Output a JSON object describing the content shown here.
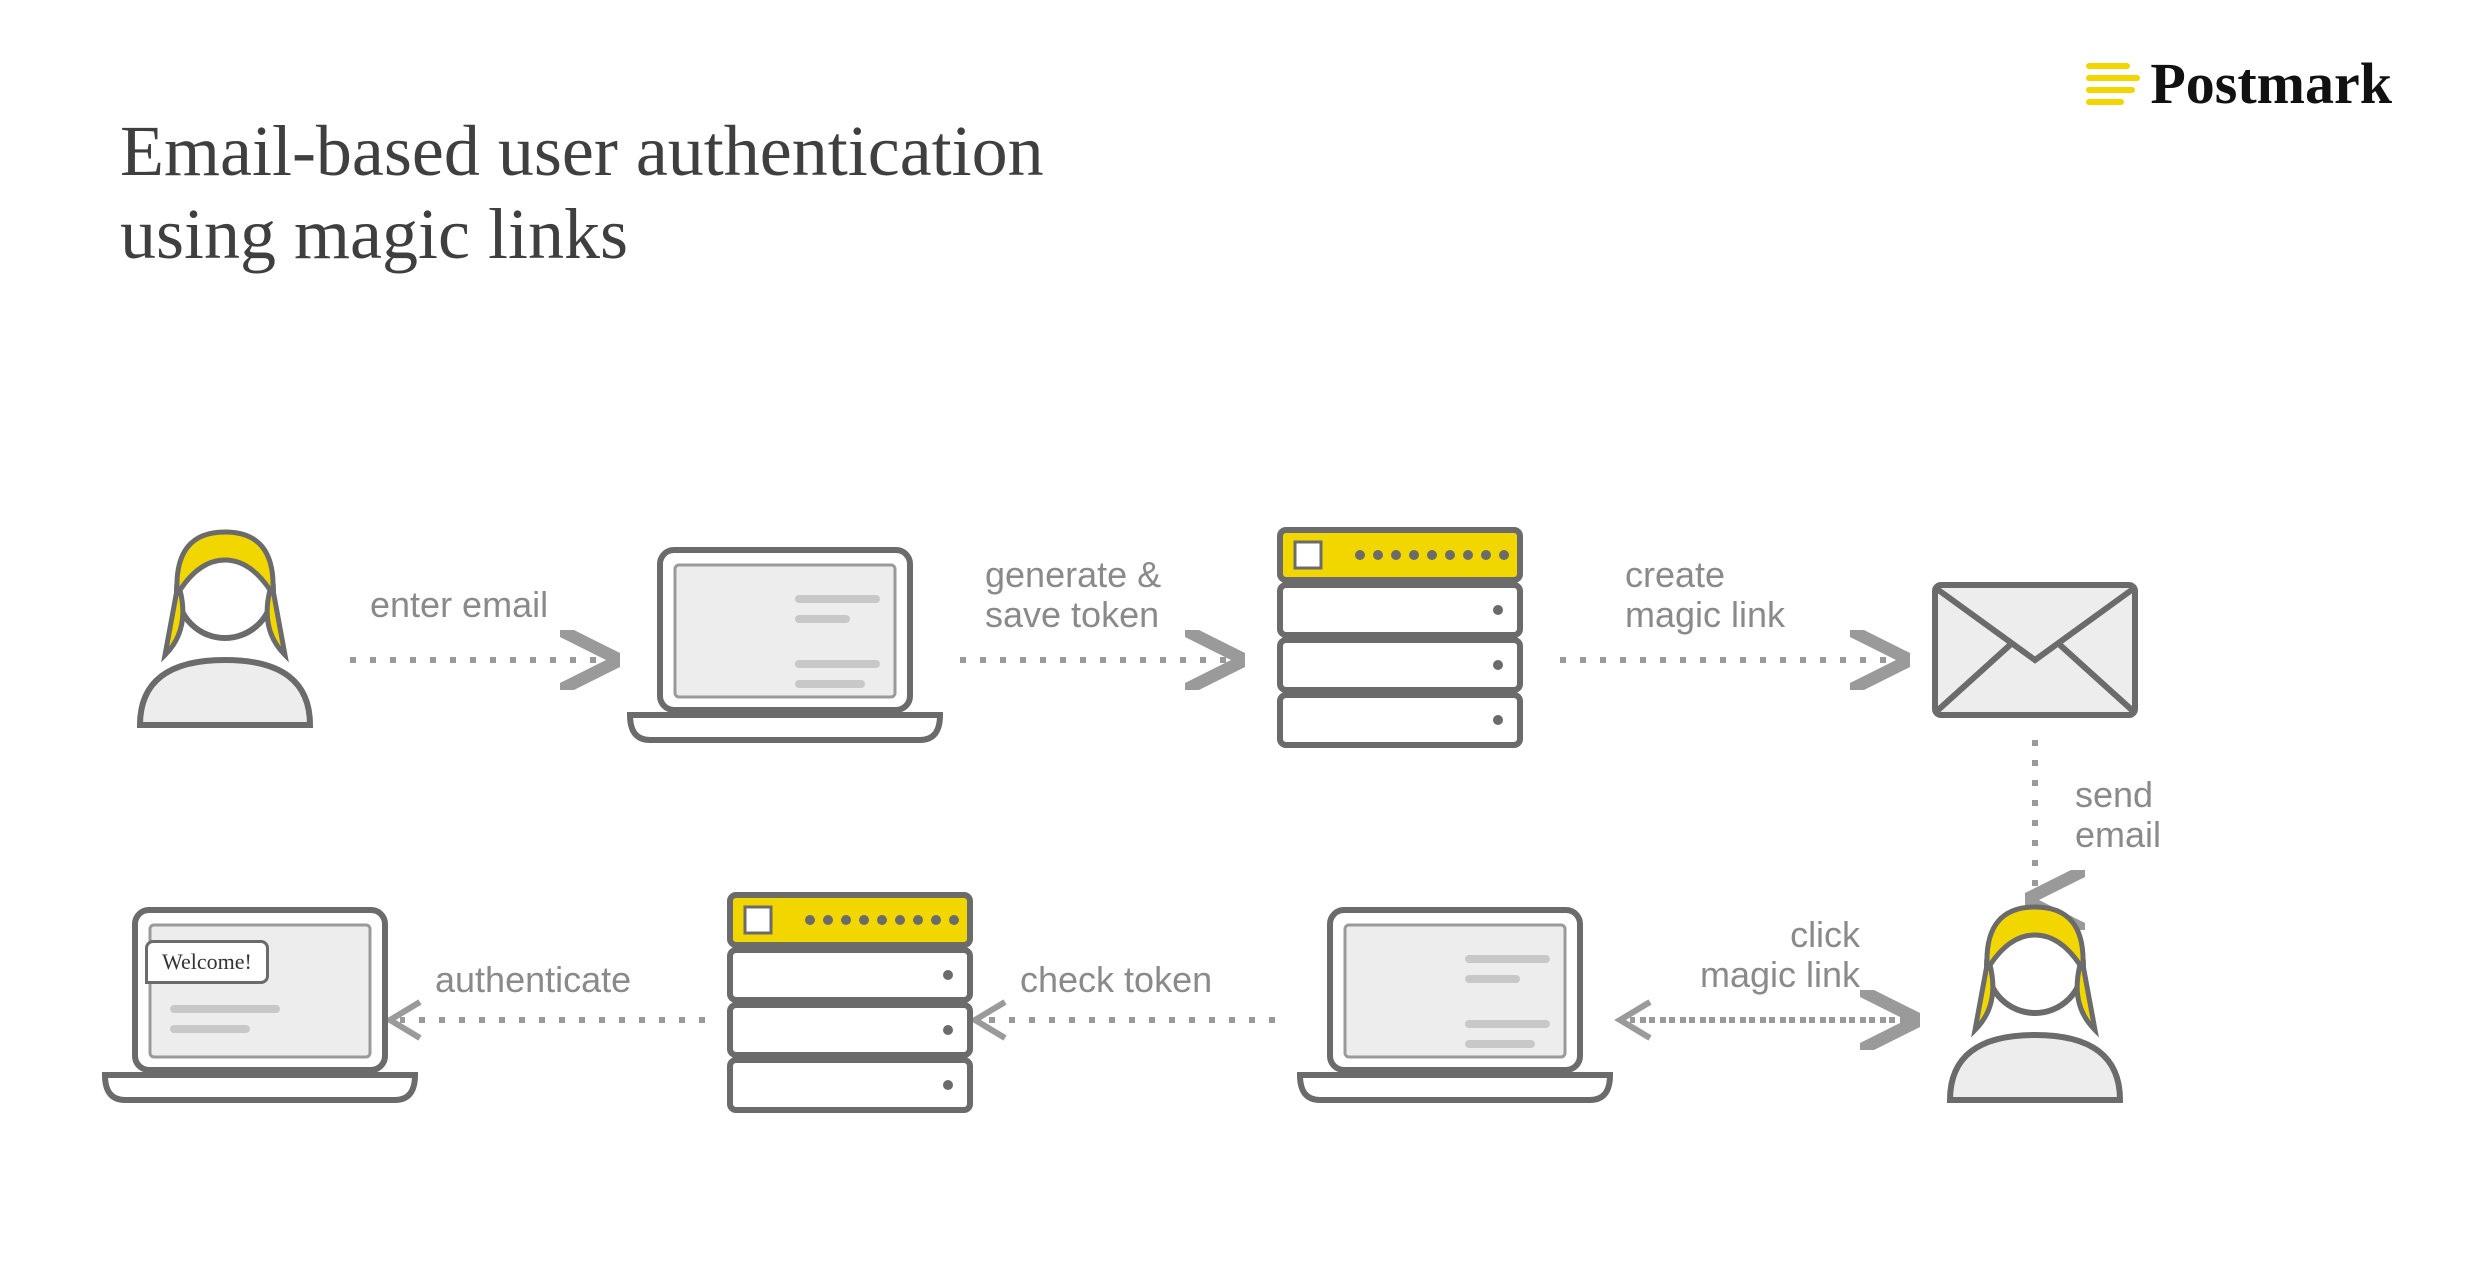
{
  "title": "Email-based user authentication\nusing magic links",
  "brand": {
    "name": "Postmark"
  },
  "colors": {
    "accent": "#f2d600",
    "stroke": "#6b6b6b",
    "text_muted": "#8a8a8a",
    "fill_light": "#ededed"
  },
  "welcome_text": "Welcome!",
  "nodes": {
    "user_top": {
      "id": "user-top",
      "icon": "person",
      "row": "top"
    },
    "laptop_form": {
      "id": "laptop-form",
      "icon": "laptop-form",
      "row": "top"
    },
    "server_top": {
      "id": "server-top",
      "icon": "server",
      "row": "top"
    },
    "envelope": {
      "id": "envelope",
      "icon": "envelope",
      "row": "top"
    },
    "user_bottom": {
      "id": "user-bottom",
      "icon": "person",
      "row": "bottom"
    },
    "laptop_browser": {
      "id": "laptop-browser",
      "icon": "laptop-browser",
      "row": "bottom"
    },
    "server_bottom": {
      "id": "server-bottom",
      "icon": "server",
      "row": "bottom"
    },
    "laptop_welcome": {
      "id": "laptop-welcome",
      "icon": "laptop-welcome",
      "row": "bottom"
    }
  },
  "arrows": [
    {
      "from": "user_top",
      "to": "laptop_form",
      "label": "enter email",
      "dir": "right"
    },
    {
      "from": "laptop_form",
      "to": "server_top",
      "label": "generate &\nsave token",
      "dir": "right"
    },
    {
      "from": "server_top",
      "to": "envelope",
      "label": "create\nmagic link",
      "dir": "right"
    },
    {
      "from": "envelope",
      "to": "user_bottom",
      "label": "send\nemail",
      "dir": "down"
    },
    {
      "from": "user_bottom",
      "to": "laptop_browser",
      "label": "click\nmagic link",
      "dir": "left"
    },
    {
      "from": "laptop_browser",
      "to": "server_bottom",
      "label": "check token",
      "dir": "left"
    },
    {
      "from": "server_bottom",
      "to": "laptop_welcome",
      "label": "authenticate",
      "dir": "left"
    }
  ]
}
